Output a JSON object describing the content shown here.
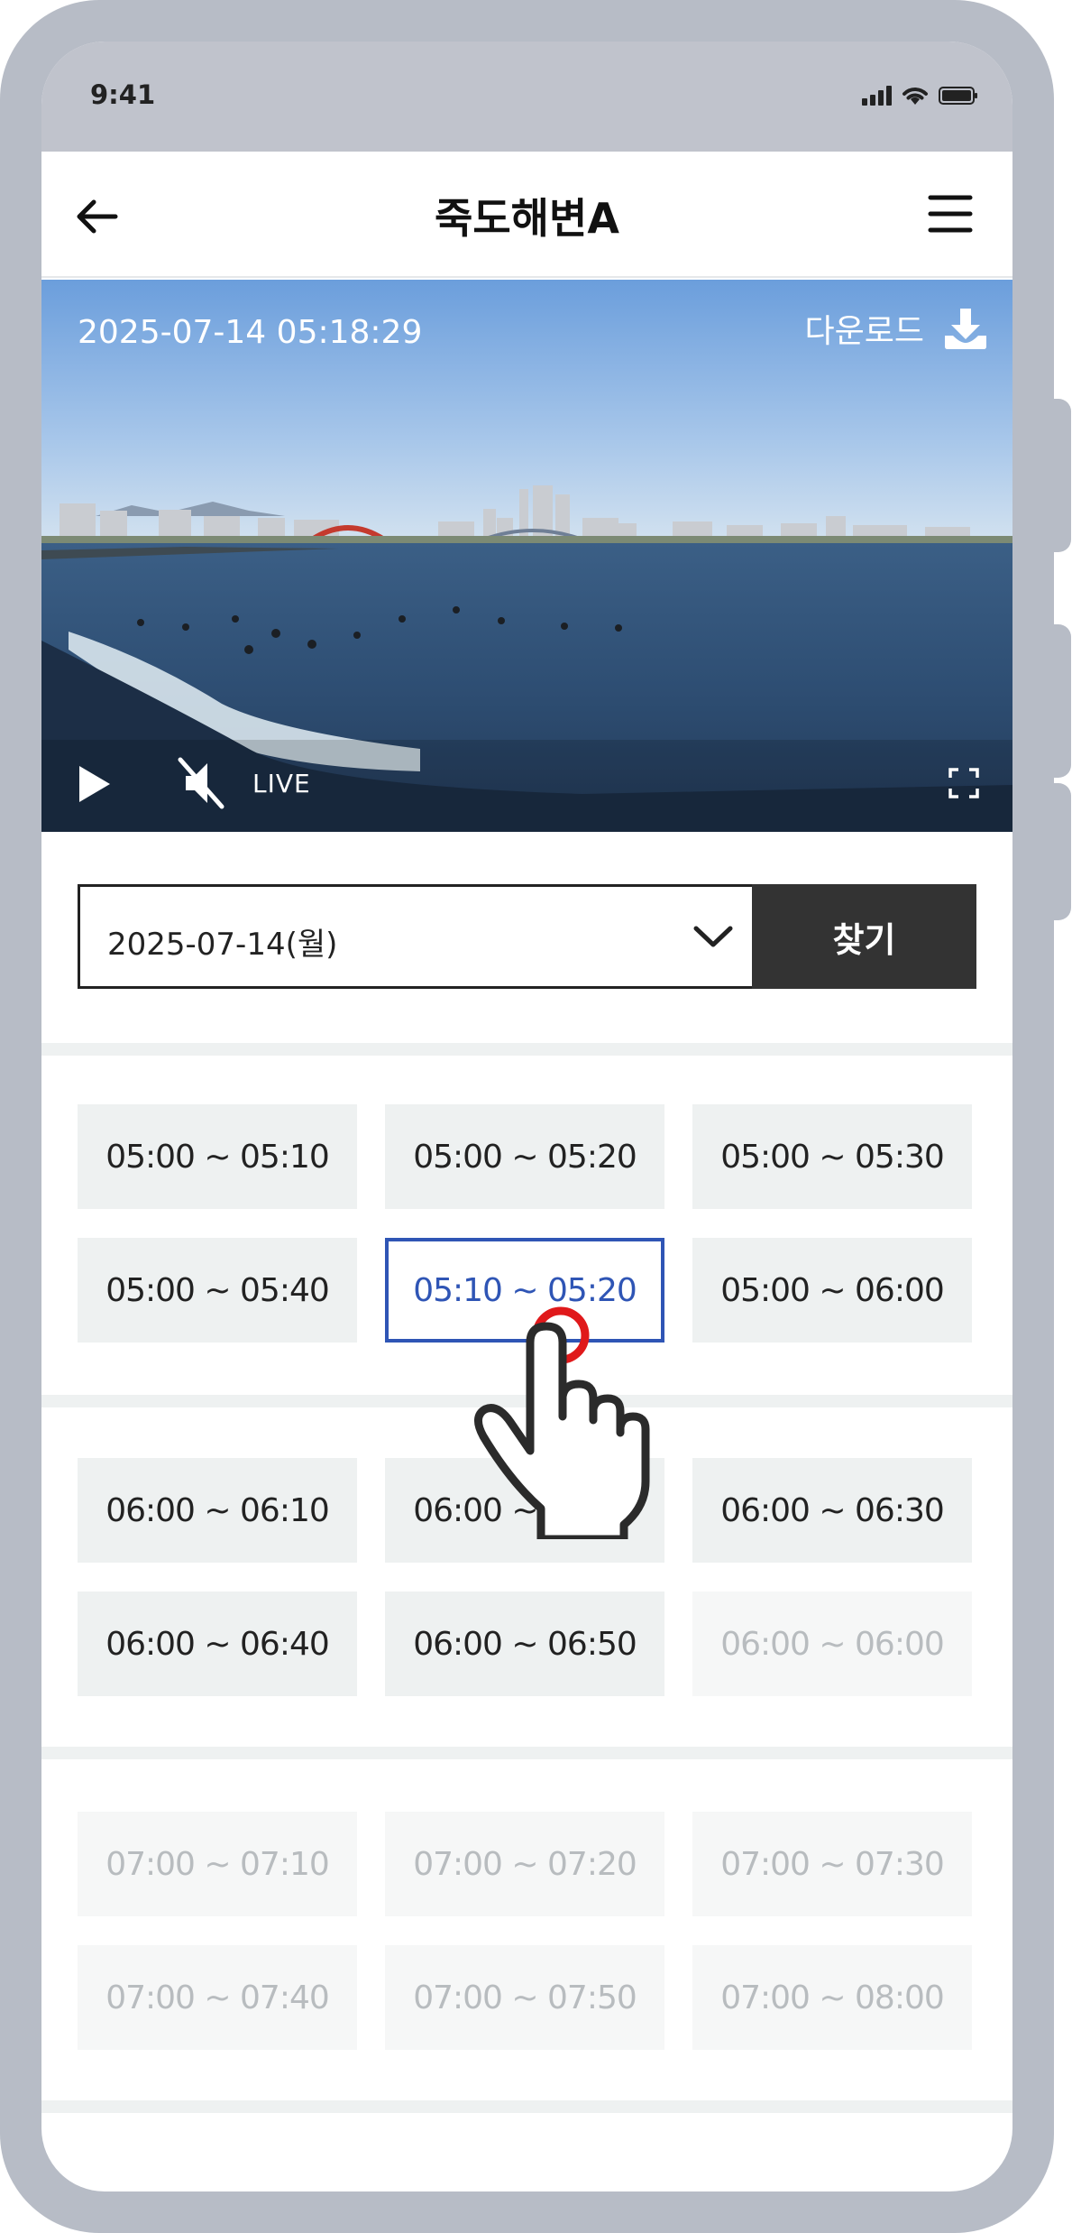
{
  "status": {
    "time": "9:41"
  },
  "header": {
    "title": "죽도해변A"
  },
  "video": {
    "timestamp": "2025-07-14 05:18:29",
    "download_label": "다운로드",
    "live_label": "LIVE"
  },
  "search": {
    "date_value": "2025-07-14(월)",
    "find_label": "찾기"
  },
  "slot_groups": [
    [
      {
        "label": "05:00 ~ 05:10",
        "state": "enabled"
      },
      {
        "label": "05:00 ~ 05:20",
        "state": "enabled"
      },
      {
        "label": "05:00 ~ 05:30",
        "state": "enabled"
      },
      {
        "label": "05:00 ~ 05:40",
        "state": "enabled"
      },
      {
        "label": "05:10 ~ 05:20",
        "state": "selected"
      },
      {
        "label": "05:00 ~ 06:00",
        "state": "enabled"
      }
    ],
    [
      {
        "label": "06:00 ~ 06:10",
        "state": "enabled"
      },
      {
        "label": "06:00 ~ 06:20",
        "state": "enabled"
      },
      {
        "label": "06:00 ~ 06:30",
        "state": "enabled"
      },
      {
        "label": "06:00 ~ 06:40",
        "state": "enabled"
      },
      {
        "label": "06:00 ~ 06:50",
        "state": "enabled"
      },
      {
        "label": "06:00 ~ 06:00",
        "state": "disabled"
      }
    ],
    [
      {
        "label": "07:00 ~ 07:10",
        "state": "disabled"
      },
      {
        "label": "07:00 ~ 07:20",
        "state": "disabled"
      },
      {
        "label": "07:00 ~ 07:30",
        "state": "disabled"
      },
      {
        "label": "07:00 ~ 07:40",
        "state": "disabled"
      },
      {
        "label": "07:00 ~ 07:50",
        "state": "disabled"
      },
      {
        "label": "07:00 ~ 08:00",
        "state": "disabled"
      }
    ]
  ],
  "colors": {
    "accent": "#2f55b5",
    "find_button": "#333333",
    "tap_ring": "#e0191b"
  },
  "icons": [
    "back-arrow-icon",
    "hamburger-menu-icon",
    "download-icon",
    "play-icon",
    "mute-icon",
    "fullscreen-icon",
    "chevron-down-icon",
    "hand-pointer-icon"
  ]
}
